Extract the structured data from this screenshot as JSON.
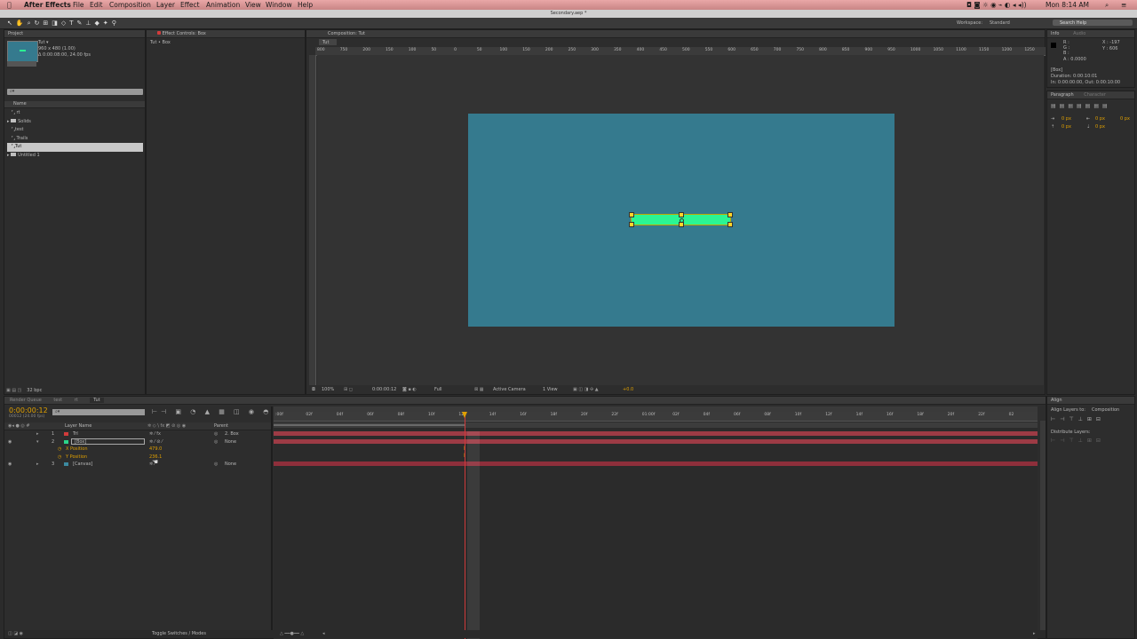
{
  "menubar": {
    "app": "After Effects",
    "items": [
      "File",
      "Edit",
      "Composition",
      "Layer",
      "Effect",
      "Animation",
      "View",
      "Window",
      "Help"
    ],
    "clock": "Mon 8:14 AM"
  },
  "window_title": "Secondary.aep *",
  "workspace": {
    "label": "Workspace:",
    "value": "Standard"
  },
  "search_help": {
    "placeholder": "Search Help"
  },
  "project_panel": {
    "tab": "Project",
    "item_name": "Tut ▾",
    "item_info1": "960 x 480 (1.00)",
    "item_info2": "Δ 0:00:08:00, 24.00 fps",
    "search_placeholder": "⌕▾",
    "column_name": "Name",
    "items": [
      {
        "label": "rt"
      },
      {
        "label": "Solids"
      },
      {
        "label": "test"
      },
      {
        "label": "Trails"
      },
      {
        "label": "Tut"
      },
      {
        "label": "Untitled 1"
      }
    ],
    "bpc": "32 bpc"
  },
  "effect_controls": {
    "tab": "Effect Controls: Box",
    "header": "Tut • Box"
  },
  "composition": {
    "tab": "Composition: Tut",
    "subtab": "Tut",
    "ruler_labels": [
      "800",
      "750",
      "200",
      "150",
      "100",
      "50",
      "0",
      "50",
      "100",
      "150",
      "200",
      "250",
      "300",
      "350",
      "400",
      "450",
      "500",
      "550",
      "600",
      "650",
      "700",
      "750",
      "800",
      "850",
      "900",
      "950",
      "1000",
      "1050",
      "1100",
      "1150",
      "1200",
      "1250"
    ],
    "canvas_color": "#357a8e",
    "box_color": "#2bf593",
    "footer": {
      "zoom": "100%",
      "timecode": "0:00:00:12",
      "resolution": "Full",
      "camera": "Active Camera",
      "view": "1 View",
      "offset": "+0.0"
    }
  },
  "info_panel": {
    "tabs": [
      "Info",
      "Audio"
    ],
    "x": "X : -197",
    "y": "Y : 606",
    "r": "R :",
    "g": "G :",
    "b": "B :",
    "a": "A : 0.0000",
    "layer": "[Box]",
    "duration": "Duration: 0:00:10:01",
    "inout": "In: 0:00:00:00, Out: 0:00:10:00"
  },
  "paragraph_panel": {
    "tabs": [
      "Paragraph",
      "Character"
    ],
    "px": [
      "0 px",
      "0 px",
      "0 px",
      "0 px",
      "0 px"
    ]
  },
  "timeline": {
    "tabs": [
      "Render Queue",
      "test",
      "rt",
      "Tut"
    ],
    "timecode": "0:00:00:12",
    "frames": "00012 (24.00 fps)",
    "search_placeholder": "⌕▾",
    "col_layer_name": "Layer Name",
    "col_parent": "Parent",
    "ruler_labels": [
      ":00f",
      "02f",
      "04f",
      "06f",
      "08f",
      "10f",
      "12f",
      "14f",
      "16f",
      "18f",
      "20f",
      "22f",
      "01:00f",
      "02f",
      "04f",
      "06f",
      "08f",
      "10f",
      "12f",
      "14f",
      "16f",
      "18f",
      "20f",
      "22f",
      "02"
    ],
    "layers": [
      {
        "num": "1",
        "name": "Trl",
        "color": "#d23b3b",
        "parent": "2. Box"
      },
      {
        "num": "2",
        "name": "[Box]",
        "color": "#2bd48a",
        "parent": "None"
      },
      {
        "num": "3",
        "name": "[Canvas]",
        "color": "#3c8aa0",
        "parent": "None"
      }
    ],
    "props": [
      {
        "name": "X Position",
        "value": "479.0"
      },
      {
        "name": "Y Position",
        "value": "236.1"
      }
    ],
    "footer": "Toggle Switches / Modes"
  },
  "align_panel": {
    "tab": "Align",
    "align_to_label": "Align Layers to:",
    "align_to_value": "Composition",
    "distribute_label": "Distribute Layers:"
  }
}
